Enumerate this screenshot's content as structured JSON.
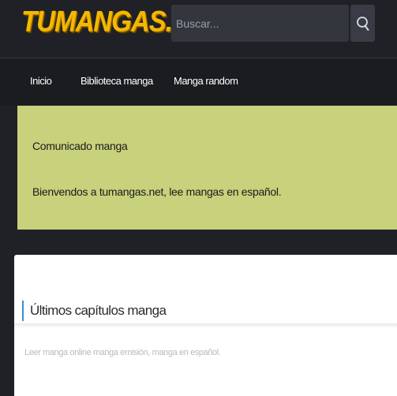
{
  "header": {
    "logo_text": "TUMANGAS.NET",
    "search_placeholder": "Buscar...",
    "search_icon": "search-icon"
  },
  "nav": {
    "items": [
      {
        "label": "Inicio"
      },
      {
        "label": "Biblioteca manga"
      },
      {
        "label": "Manga random"
      }
    ]
  },
  "notice": {
    "title": "Comunicado manga",
    "text": "Bienvendos a tumangas.net, lee mangas en español."
  },
  "latest": {
    "heading": "Últimos capítulos manga",
    "subtitle": "Leer manga online manga emisión, manga en español."
  },
  "colors": {
    "logo": "#f5b800",
    "header_bg": "#1f2126",
    "nav_bg": "#1a1c20",
    "notice_bg": "#c8d17b",
    "accent": "#3d8ed6"
  }
}
